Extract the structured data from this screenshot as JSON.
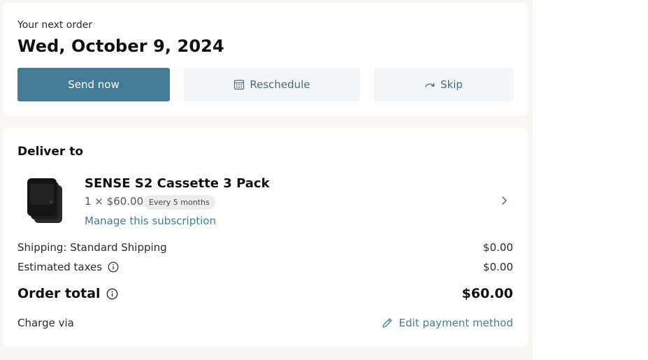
{
  "next_order": {
    "label": "Your next order",
    "date": "Wed, October 9, 2024"
  },
  "actions": {
    "send_now": "Send now",
    "reschedule": "Reschedule",
    "skip": "Skip"
  },
  "deliver": {
    "title": "Deliver to",
    "product": {
      "name": "SENSE S2 Cassette 3 Pack",
      "quantity_price": "1 × $60.00",
      "frequency_badge": "Every 5 months",
      "manage_link": "Manage this subscription"
    }
  },
  "summary": {
    "shipping_label": "Shipping: Standard Shipping",
    "shipping_value": "$0.00",
    "taxes_label": "Estimated taxes",
    "taxes_value": "$0.00",
    "total_label": "Order total",
    "total_value": "$60.00",
    "charge_label": "Charge via",
    "edit_payment": "Edit payment method"
  },
  "colors": {
    "accent": "#467b98",
    "secondary_button_bg": "#f3f5f7",
    "page_bg": "#f7f6f3"
  },
  "icons": {
    "reschedule": "calendar-icon",
    "skip": "skip-arrow-icon",
    "info": "info-icon",
    "edit": "pencil-icon",
    "chevron": "chevron-right-icon"
  }
}
